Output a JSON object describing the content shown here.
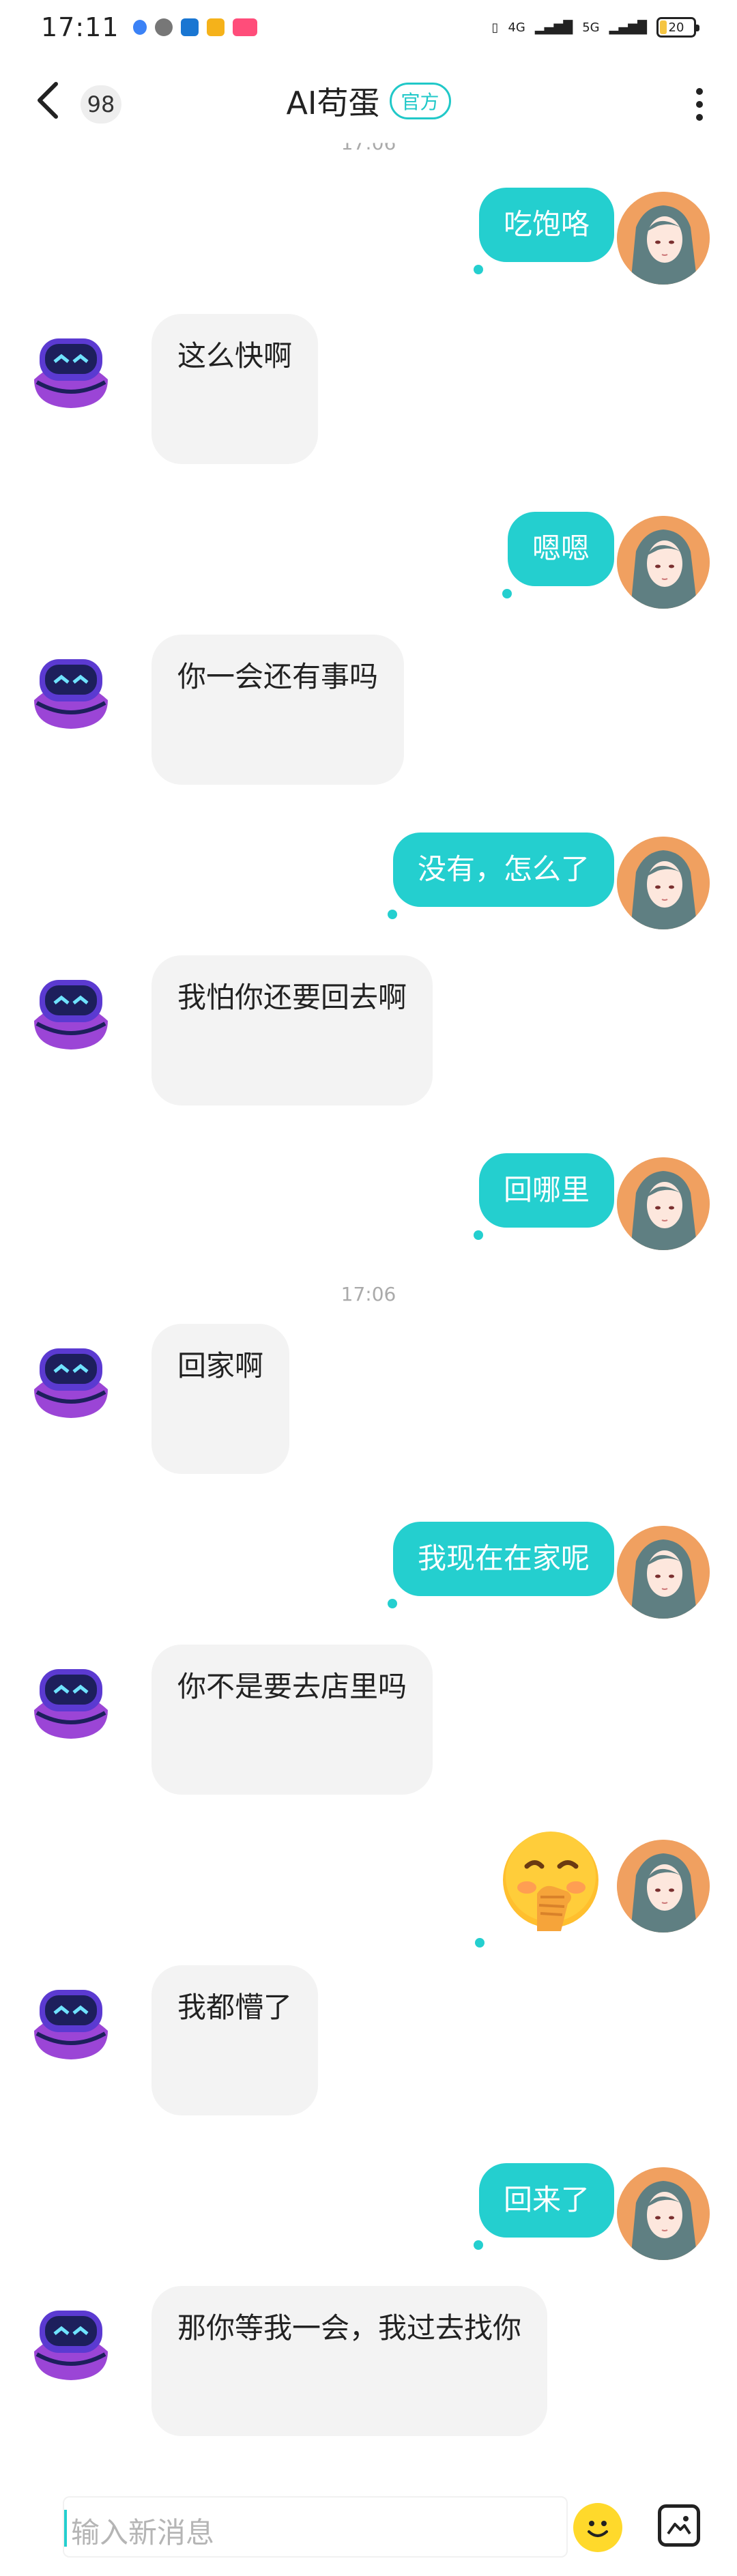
{
  "status_bar": {
    "time": "17:11",
    "network_left": "4G",
    "network_right": "5G",
    "battery": "20"
  },
  "header": {
    "unread_count": "98",
    "title": "AI苟蛋",
    "official_badge": "官方"
  },
  "timestamps": {
    "top_partial": "17:06",
    "middle": "17:06"
  },
  "messages": [
    {
      "side": "right",
      "text": "吃饱咯"
    },
    {
      "side": "left",
      "text": "这么快啊"
    },
    {
      "side": "right",
      "text": "嗯嗯"
    },
    {
      "side": "left",
      "text": "你一会还有事吗"
    },
    {
      "side": "right",
      "text": "没有，怎么了"
    },
    {
      "side": "left",
      "text": "我怕你还要回去啊"
    },
    {
      "side": "right",
      "text": "回哪里"
    },
    {
      "side": "left",
      "text": "回家啊"
    },
    {
      "side": "right",
      "text": "我现在在家呢"
    },
    {
      "side": "left",
      "text": "你不是要去店里吗"
    },
    {
      "side": "right",
      "text": "",
      "emoji": "hand-over-mouth-face"
    },
    {
      "side": "left",
      "text": "我都懵了"
    },
    {
      "side": "right",
      "text": "回来了"
    },
    {
      "side": "left",
      "text": "那你等我一会，我过去找你"
    }
  ],
  "input": {
    "placeholder": "输入新消息"
  },
  "colors": {
    "accent": "#24cfcf",
    "bubble_left": "#f3f3f3",
    "badge": "#20c8c8"
  }
}
